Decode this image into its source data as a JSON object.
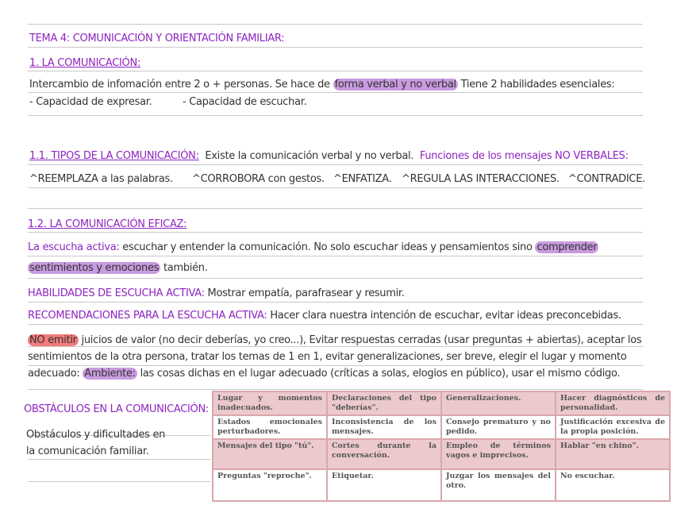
{
  "title": "TEMA 4: COMUNICACIÓN Y ORIENTACIÓN FAMILIAR:",
  "s1": {
    "heading": "1. LA COMUNICACIÓN:",
    "text_a": "Intercambio de infomación entre 2 o + personas. Se hace de ",
    "highlight": "forma verbal y no verbal",
    "text_b": " Tiene 2 habilidades esenciales:",
    "item1": "- Capacidad de expresar.",
    "item2": "- Capacidad de escuchar."
  },
  "s11": {
    "heading": "1.1. TIPOS DE LA COMUNICACIÓN:",
    "text": "Existe la comunicación verbal y no verbal.",
    "functions": "Funciones de los mensajes NO VERBALES:",
    "items": [
      "^REEMPLAZA a las palabras.",
      "^CORROBORA con gestos.",
      "^ENFATIZA.",
      "^REGULA LAS INTERACCIONES.",
      "^CONTRADICE."
    ]
  },
  "s12": {
    "heading": "1.2. LA COMUNICACIÓN EFICAZ:",
    "escucha_label": "La escucha activa:",
    "escucha_text": " escuchar y entender la comunicación. No solo escuchar ideas y pensamientos sino ",
    "hl1": "comprender",
    "hl2": "sentimientos y emociones",
    "tambien": " también.",
    "hab_label": "HABILIDADES DE ESCUCHA ACTIVA:",
    "hab_text": " Mostrar empatía, parafrasear y resumir.",
    "rec_label": "RECOMENDACIONES PARA LA ESCUCHA ACTIVA:",
    "rec_text": "  Hacer clara nuestra intención de escuchar, evitar ideas preconcebidas.",
    "no_emitir": "NO emitir",
    "p1": " juicios de valor (no decir deberías, yo creo...), Evitar respuestas cerradas (usar preguntas + abiertas), aceptar los",
    "p2": "sentimientos de la otra persona, tratar los temas de 1 en 1, evitar generalizaciones, ser breve, elegir el lugar y momento",
    "p3a": "adecuado:  ",
    "ambiente": "Ambiente:",
    "p3b": " las cosas dichas en el lugar adecuado (críticas a solas, elogios en público), usar el mismo código."
  },
  "obst": {
    "heading": "OBSTÁCULOS EN LA COMUNICACIÓN:",
    "line1": "Obstáculos y dificultades en",
    "line2": "la comunicación familiar.",
    "table": [
      [
        "Lugar y momentos inadecuados.",
        "Declaraciones del tipo \"deberías\".",
        "Generalizaciones.",
        "Hacer diagnósticos de personalidad."
      ],
      [
        "Estados emocionales perturbadores.",
        "Inconsistencia de los mensajes.",
        "Consejo prematuro y no pedido.",
        "Justificación excesiva de la propia posición."
      ],
      [
        "Mensajes del tipo \"tú\".",
        "Cortes durante la conversación.",
        "Empleo de términos vagos e imprecisos.",
        "Hablar \"en chino\"."
      ],
      [
        "Preguntas \"reproche\".",
        "Etiquetar.",
        "Juzgar los mensajes del otro.",
        "No escuchar."
      ]
    ]
  }
}
